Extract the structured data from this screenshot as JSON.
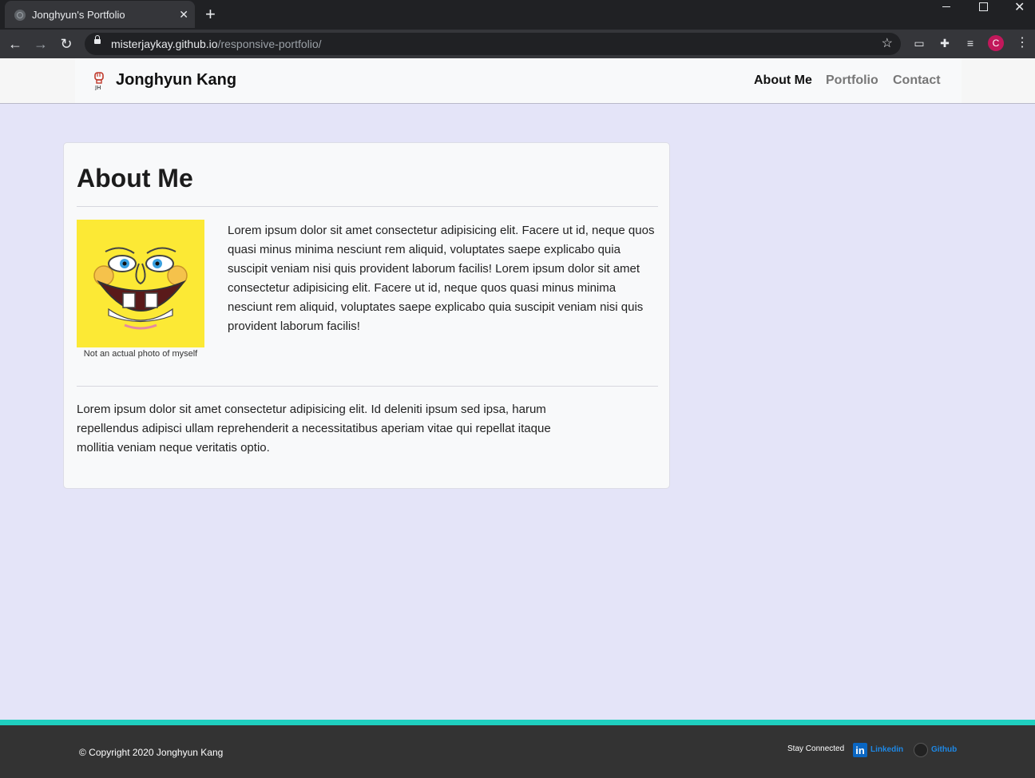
{
  "browser": {
    "tab_title": "Jonghyun's Portfolio",
    "tab_close": "✕",
    "new_tab": "+",
    "url_host": "misterjaykay.github.io",
    "url_path": "/responsive-portfolio/",
    "profile_initial": "C",
    "icons": [
      "globe-icon",
      "close-icon",
      "plus-icon",
      "minimize-icon",
      "maximize-icon",
      "window-close-icon",
      "back-arrow-icon",
      "forward-arrow-icon",
      "reload-icon",
      "lock-icon",
      "star-icon",
      "cast-icon",
      "puzzle-icon",
      "media-control-icon",
      "menu-dots-icon"
    ]
  },
  "header": {
    "brand": "Jonghyun Kang",
    "nav": [
      {
        "label": "About Me"
      },
      {
        "label": "Portfolio"
      },
      {
        "label": "Contact"
      }
    ]
  },
  "main": {
    "title": "About Me",
    "photo_caption": "Not an actual photo of myself",
    "paragraph1": "Lorem ipsum dolor sit amet consectetur adipisicing elit. Facere ut id, neque quos quasi minus minima nesciunt rem aliquid, voluptates saepe explicabo quia suscipit veniam nisi quis provident laborum facilis! Lorem ipsum dolor sit amet consectetur adipisicing elit. Facere ut id, neque quos quasi minus minima nesciunt rem aliquid, voluptates saepe explicabo quia suscipit veniam nisi quis provident laborum facilis!",
    "paragraph2": "Lorem ipsum dolor sit amet consectetur adipisicing elit. Id deleniti ipsum sed ipsa, harum repellendus adipisci ullam reprehenderit a necessitatibus aperiam vitae qui repellat itaque mollitia veniam neque veritatis optio."
  },
  "footer": {
    "copyright": "© Copyright 2020 Jonghyun Kang",
    "stay_connected": "Stay Connected",
    "linkedin": "Linkedin",
    "github": "Github"
  },
  "colors": {
    "page_bg": "#e4e4f8",
    "footer_accent": "#1fcfbf",
    "footer_bg": "#333333",
    "link_blue": "#1e88e5"
  }
}
